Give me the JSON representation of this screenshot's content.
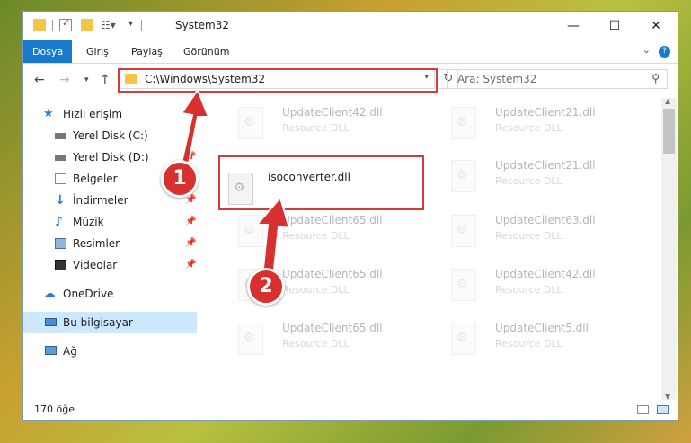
{
  "window": {
    "title": "System32",
    "minimize_icon": "minimize-icon",
    "maximize_icon": "maximize-icon",
    "close_icon": "close-icon"
  },
  "ribbon": {
    "tabs": [
      "Dosya",
      "Giriş",
      "Paylaş",
      "Görünüm"
    ],
    "help": "?",
    "accent": "#1979ca"
  },
  "nav": {
    "address": "C:\\Windows\\System32",
    "search_placeholder": "Ara: System32"
  },
  "sidebar": {
    "items": [
      {
        "label": "Hızlı erişim",
        "icon": "star-icon"
      },
      {
        "label": "Yerel Disk (C:)",
        "icon": "drive-icon"
      },
      {
        "label": "Yerel Disk (D:)",
        "icon": "drive-icon"
      },
      {
        "label": "Belgeler",
        "icon": "documents-icon"
      },
      {
        "label": "İndirmeler",
        "icon": "download-icon"
      },
      {
        "label": "Müzik",
        "icon": "music-icon"
      },
      {
        "label": "Resimler",
        "icon": "pictures-icon"
      },
      {
        "label": "Videolar",
        "icon": "videos-icon"
      },
      {
        "label": "OneDrive",
        "icon": "cloud-icon"
      },
      {
        "label": "Bu bilgisayar",
        "icon": "computer-icon"
      },
      {
        "label": "Ağ",
        "icon": "network-icon"
      }
    ]
  },
  "files": [
    {
      "name": "UpdateClient42.dll",
      "type": "Resource DLL"
    },
    {
      "name": "UpdateClient21.dll",
      "type": "Resource DLL"
    },
    {
      "name": "isoconverter.dll",
      "type": ""
    },
    {
      "name": "UpdateClient21.dll",
      "type": "Resource DLL"
    },
    {
      "name": "UpdateClient65.dll",
      "type": "Resource DLL"
    },
    {
      "name": "UpdateClient63.dll",
      "type": "Resource DLL"
    },
    {
      "name": "UpdateClient65.dll",
      "type": "Resource DLL"
    },
    {
      "name": "UpdateClient42.dll",
      "type": "Resource DLL"
    },
    {
      "name": "UpdateClient65.dll",
      "type": "Resource DLL"
    },
    {
      "name": "UpdateClient5.dll",
      "type": "Resource DLL"
    }
  ],
  "status": {
    "count": "170 öğe"
  },
  "markers": {
    "one": "1",
    "two": "2",
    "color": "#d8302e"
  }
}
